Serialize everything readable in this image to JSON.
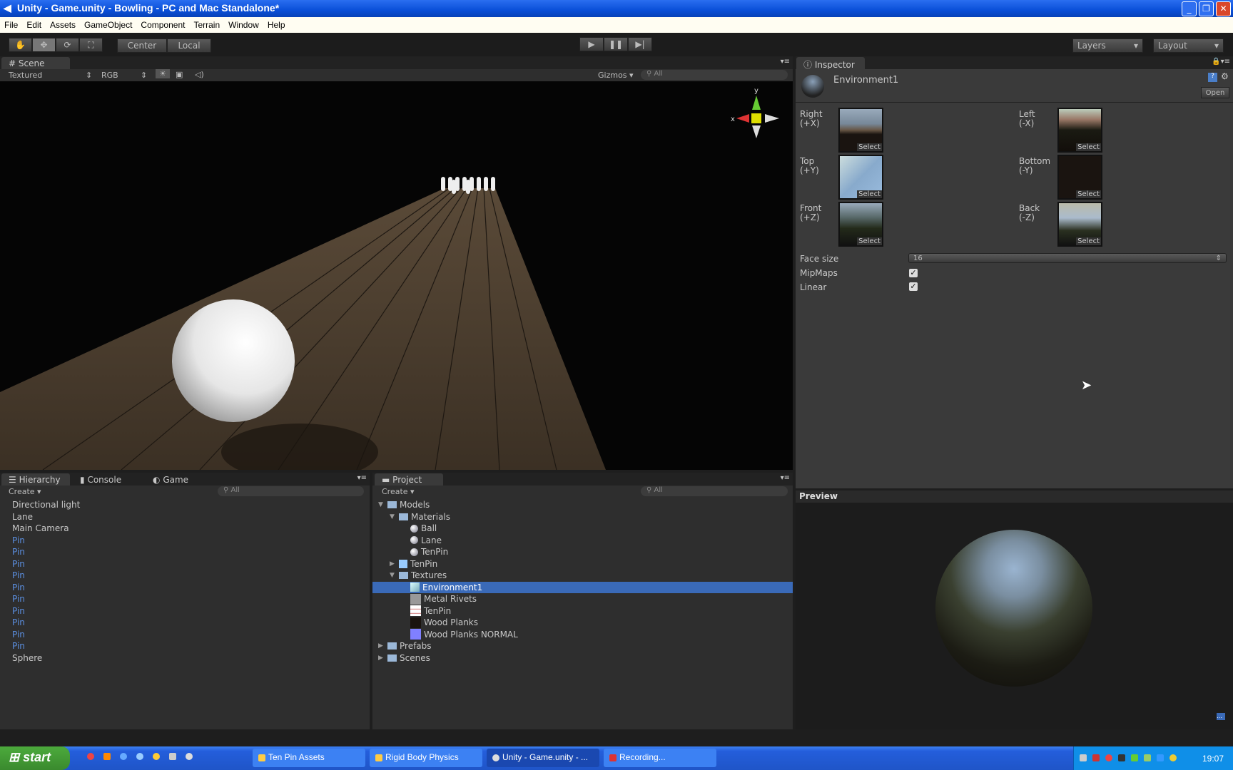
{
  "window": {
    "title": "Unity - Game.unity - Bowling - PC and Mac Standalone*"
  },
  "menu": [
    "File",
    "Edit",
    "Assets",
    "GameObject",
    "Component",
    "Terrain",
    "Window",
    "Help"
  ],
  "toolbar": {
    "center": "Center",
    "local": "Local",
    "layers": "Layers",
    "layout": "Layout"
  },
  "scene": {
    "tab": "Scene",
    "render_mode": "Textured",
    "channel": "RGB",
    "gizmos": "Gizmos",
    "search": "All",
    "axis_x": "x",
    "axis_y": "y"
  },
  "inspector": {
    "tab": "Inspector",
    "asset_name": "Environment1",
    "open": "Open",
    "faces": [
      {
        "label": "Right",
        "axis": "(+X)"
      },
      {
        "label": "Left",
        "axis": "(-X)"
      },
      {
        "label": "Top",
        "axis": "(+Y)"
      },
      {
        "label": "Bottom",
        "axis": "(-Y)"
      },
      {
        "label": "Front",
        "axis": "(+Z)"
      },
      {
        "label": "Back",
        "axis": "(-Z)"
      }
    ],
    "select": "Select",
    "face_size_label": "Face size",
    "face_size": "16",
    "mipmaps_label": "MipMaps",
    "mipmaps": true,
    "linear_label": "Linear",
    "linear": true,
    "preview": "Preview"
  },
  "hierarchy": {
    "tabs": [
      "Hierarchy",
      "Console",
      "Game"
    ],
    "create": "Create",
    "search": "All",
    "items": [
      "Directional light",
      "Lane",
      "Main Camera",
      "Pin",
      "Pin",
      "Pin",
      "Pin",
      "Pin",
      "Pin",
      "Pin",
      "Pin",
      "Pin",
      "Pin",
      "Sphere"
    ]
  },
  "project": {
    "tab": "Project",
    "create": "Create",
    "search": "All",
    "items": [
      {
        "label": "Models",
        "depth": 0,
        "type": "folder",
        "arrow": "open"
      },
      {
        "label": "Materials",
        "depth": 1,
        "type": "folder",
        "arrow": "open"
      },
      {
        "label": "Ball",
        "depth": 2,
        "type": "material"
      },
      {
        "label": "Lane",
        "depth": 2,
        "type": "material"
      },
      {
        "label": "TenPin",
        "depth": 2,
        "type": "material"
      },
      {
        "label": "TenPin",
        "depth": 1,
        "type": "model",
        "arrow": "closed"
      },
      {
        "label": "Textures",
        "depth": 1,
        "type": "folder",
        "arrow": "open"
      },
      {
        "label": "Environment1",
        "depth": 2,
        "type": "cubemap",
        "selected": true
      },
      {
        "label": "Metal Rivets",
        "depth": 2,
        "type": "texture"
      },
      {
        "label": "TenPin",
        "depth": 2,
        "type": "texture"
      },
      {
        "label": "Wood Planks",
        "depth": 2,
        "type": "texture"
      },
      {
        "label": "Wood Planks NORMAL",
        "depth": 2,
        "type": "texture"
      },
      {
        "label": "Prefabs",
        "depth": 0,
        "type": "folder",
        "arrow": "closed"
      },
      {
        "label": "Scenes",
        "depth": 0,
        "type": "folder",
        "arrow": "closed"
      }
    ]
  },
  "taskbar": {
    "start": "start",
    "tasks": [
      "Ten Pin Assets",
      "Rigid Body Physics",
      "Unity - Game.unity - ...",
      "Recording..."
    ],
    "clock": "19:07"
  },
  "colors": {
    "selection": "#3a6ab8",
    "pin_text": "#5b8fe0",
    "taskbar": "#245edb"
  }
}
